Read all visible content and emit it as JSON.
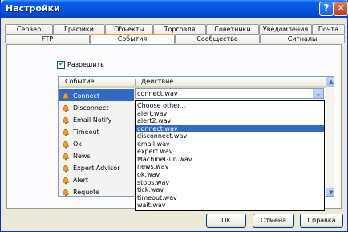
{
  "window": {
    "title": "Настройки",
    "help_glyph": "?",
    "close_glyph": "✕"
  },
  "tabs_row1": [
    "Сервер",
    "Графики",
    "Объекты",
    "Торговля",
    "Советники",
    "Уведомления",
    "Почта"
  ],
  "tabs_row2": [
    "FTP",
    "События",
    "Сообщество",
    "Сигналы"
  ],
  "active_tab": "События",
  "enable": {
    "label": "Разрешить",
    "checked": true
  },
  "table": {
    "headers": [
      "Событие",
      "Действие"
    ],
    "events": [
      "Connect",
      "Disconnect",
      "Email Notify",
      "Timeout",
      "Ok",
      "News",
      "Expert Advisor",
      "Alert",
      "Requote"
    ],
    "selected_event": "Connect"
  },
  "action_combo": {
    "value": "connect.wav",
    "arrow": "⌄"
  },
  "dropdown_options": [
    "Choose other...",
    "alert.wav",
    "alert2.wav",
    "connect.wav",
    "disconnect.wav",
    "email.wav",
    "expert.wav",
    "MachineGun.wav",
    "news.wav",
    "ok.wav",
    "stops.wav",
    "tick.wav",
    "timeout.wav",
    "wait.wav"
  ],
  "dropdown_selected": "connect.wav",
  "buttons": {
    "ok": "OK",
    "cancel": "Отмена",
    "help": "Справка"
  },
  "colors": {
    "title_bar": "#0556e0",
    "selection": "#316ac5",
    "tab_highlight": "#f1a03a"
  }
}
